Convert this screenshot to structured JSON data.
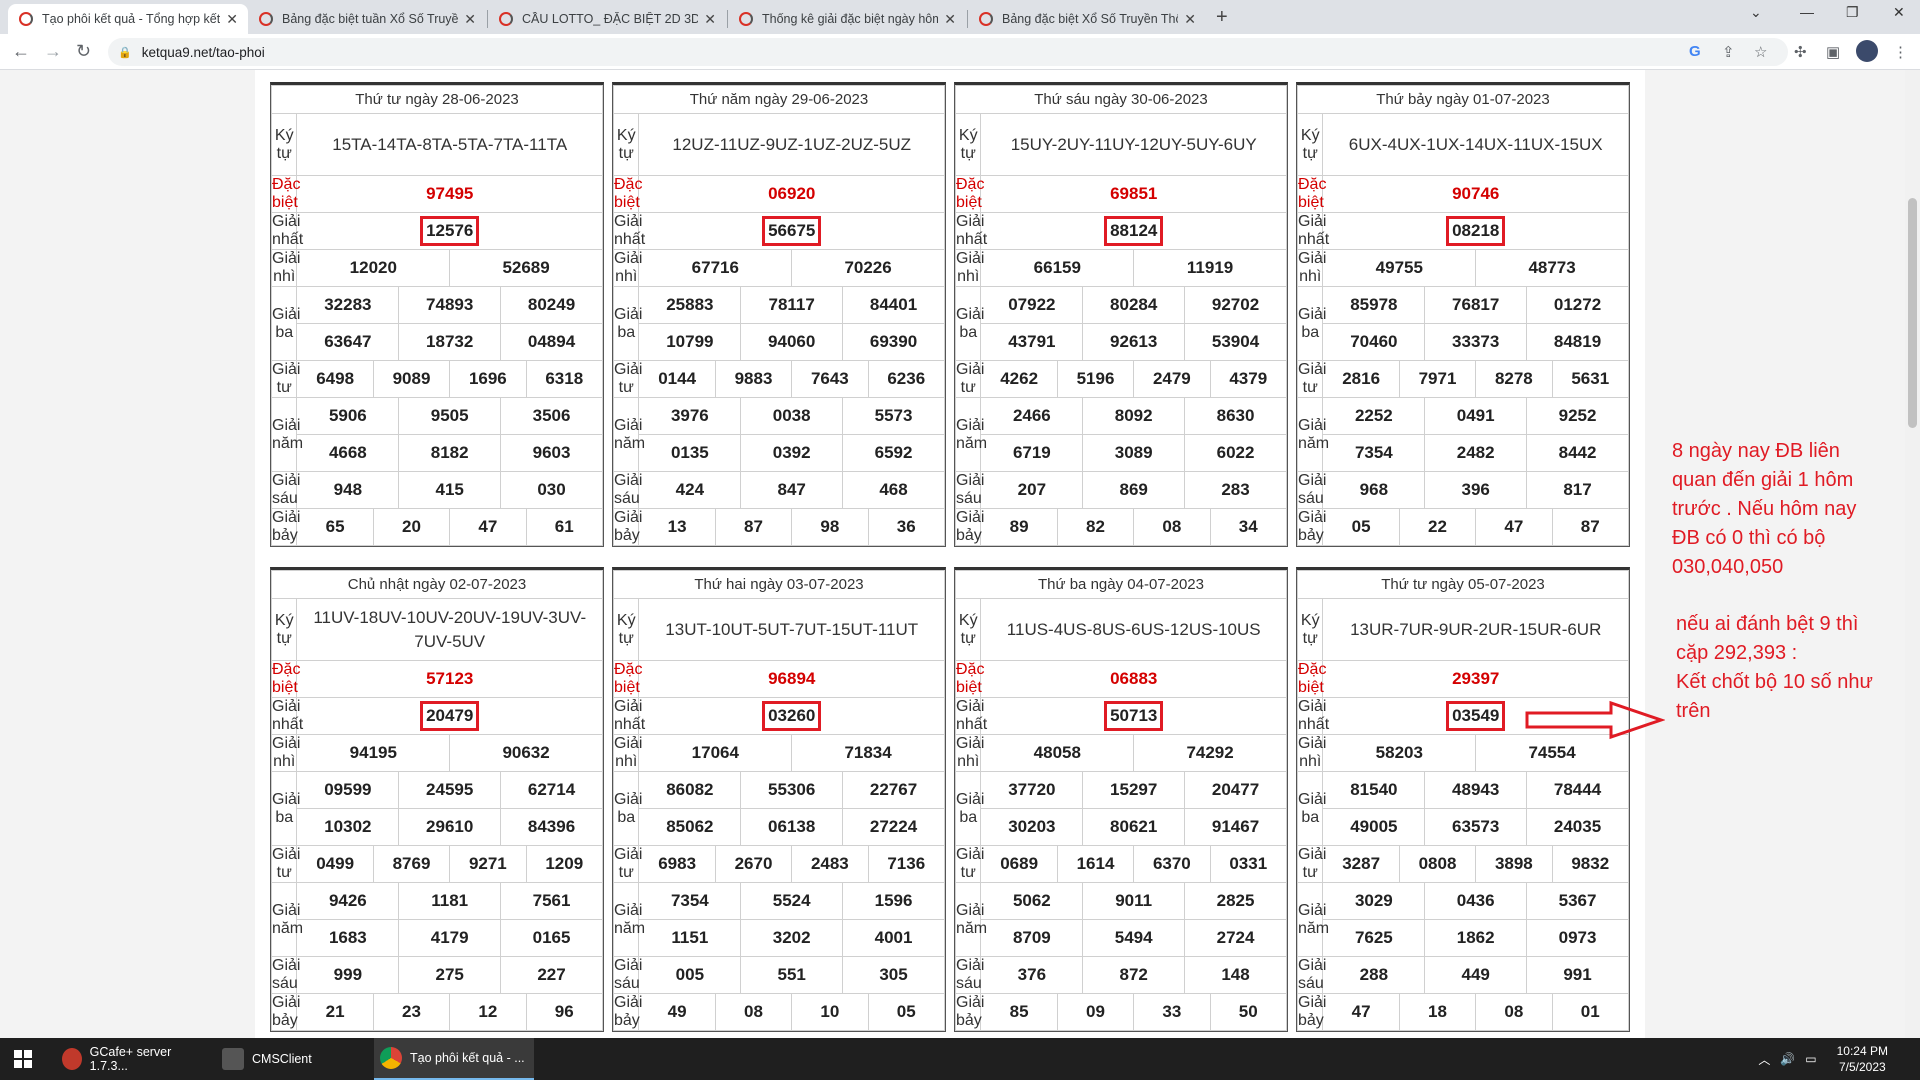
{
  "browser": {
    "tabs": [
      {
        "title": "Tạo phôi kết quả - Tổng hợp kết",
        "active": true
      },
      {
        "title": "Bảng đặc biệt tuần Xổ Số Truyền",
        "active": false
      },
      {
        "title": "CẦU LOTTO_ ĐẶC BIỆT 2D 3D 4D",
        "active": false
      },
      {
        "title": "Thống kê giải đặc biệt ngày hôm",
        "active": false
      },
      {
        "title": "Bảng đặc biệt Xổ Số Truyền Thốn",
        "active": false
      }
    ],
    "url": "ketqua9.net/tao-phoi"
  },
  "labels": {
    "kytu": "Ký tự",
    "db": "Đặc biệt",
    "g1": "Giải nhất",
    "g2": "Giải nhì",
    "g3": "Giải ba",
    "g4": "Giải tư",
    "g5": "Giải năm",
    "g6": "Giải sáu",
    "g7": "Giải bảy"
  },
  "results": [
    {
      "date": "Thứ tư ngày 28-06-2023",
      "kytu": "15TA-14TA-8TA-5TA-7TA-11TA",
      "db": "97495",
      "g1": "12576",
      "g2": [
        "12020",
        "52689"
      ],
      "g3": [
        "32283",
        "74893",
        "80249",
        "63647",
        "18732",
        "04894"
      ],
      "g4": [
        "6498",
        "9089",
        "1696",
        "6318"
      ],
      "g5": [
        "5906",
        "9505",
        "3506",
        "4668",
        "8182",
        "9603"
      ],
      "g6": [
        "948",
        "415",
        "030"
      ],
      "g7": [
        "65",
        "20",
        "47",
        "61"
      ]
    },
    {
      "date": "Thứ năm ngày 29-06-2023",
      "kytu": "12UZ-11UZ-9UZ-1UZ-2UZ-5UZ",
      "db": "06920",
      "g1": "56675",
      "g2": [
        "67716",
        "70226"
      ],
      "g3": [
        "25883",
        "78117",
        "84401",
        "10799",
        "94060",
        "69390"
      ],
      "g4": [
        "0144",
        "9883",
        "7643",
        "6236"
      ],
      "g5": [
        "3976",
        "0038",
        "5573",
        "0135",
        "0392",
        "6592"
      ],
      "g6": [
        "424",
        "847",
        "468"
      ],
      "g7": [
        "13",
        "87",
        "98",
        "36"
      ]
    },
    {
      "date": "Thứ sáu ngày 30-06-2023",
      "kytu": "15UY-2UY-11UY-12UY-5UY-6UY",
      "db": "69851",
      "g1": "88124",
      "g2": [
        "66159",
        "11919"
      ],
      "g3": [
        "07922",
        "80284",
        "92702",
        "43791",
        "92613",
        "53904"
      ],
      "g4": [
        "4262",
        "5196",
        "2479",
        "4379"
      ],
      "g5": [
        "2466",
        "8092",
        "8630",
        "6719",
        "3089",
        "6022"
      ],
      "g6": [
        "207",
        "869",
        "283"
      ],
      "g7": [
        "89",
        "82",
        "08",
        "34"
      ]
    },
    {
      "date": "Thứ bảy ngày 01-07-2023",
      "kytu": "6UX-4UX-1UX-14UX-11UX-15UX",
      "db": "90746",
      "g1": "08218",
      "g2": [
        "49755",
        "48773"
      ],
      "g3": [
        "85978",
        "76817",
        "01272",
        "70460",
        "33373",
        "84819"
      ],
      "g4": [
        "2816",
        "7971",
        "8278",
        "5631"
      ],
      "g5": [
        "2252",
        "0491",
        "9252",
        "7354",
        "2482",
        "8442"
      ],
      "g6": [
        "968",
        "396",
        "817"
      ],
      "g7": [
        "05",
        "22",
        "47",
        "87"
      ]
    },
    {
      "date": "Chủ nhật ngày 02-07-2023",
      "kytu": "11UV-18UV-10UV-20UV-19UV-3UV-7UV-5UV",
      "db": "57123",
      "g1": "20479",
      "g2": [
        "94195",
        "90632"
      ],
      "g3": [
        "09599",
        "24595",
        "62714",
        "10302",
        "29610",
        "84396"
      ],
      "g4": [
        "0499",
        "8769",
        "9271",
        "1209"
      ],
      "g5": [
        "9426",
        "1181",
        "7561",
        "1683",
        "4179",
        "0165"
      ],
      "g6": [
        "999",
        "275",
        "227"
      ],
      "g7": [
        "21",
        "23",
        "12",
        "96"
      ]
    },
    {
      "date": "Thứ hai ngày 03-07-2023",
      "kytu": "13UT-10UT-5UT-7UT-15UT-11UT",
      "db": "96894",
      "g1": "03260",
      "g2": [
        "17064",
        "71834"
      ],
      "g3": [
        "86082",
        "55306",
        "22767",
        "85062",
        "06138",
        "27224"
      ],
      "g4": [
        "6983",
        "2670",
        "2483",
        "7136"
      ],
      "g5": [
        "7354",
        "5524",
        "1596",
        "1151",
        "3202",
        "4001"
      ],
      "g6": [
        "005",
        "551",
        "305"
      ],
      "g7": [
        "49",
        "08",
        "10",
        "05"
      ]
    },
    {
      "date": "Thứ ba ngày 04-07-2023",
      "kytu": "11US-4US-8US-6US-12US-10US",
      "db": "06883",
      "g1": "50713",
      "g2": [
        "48058",
        "74292"
      ],
      "g3": [
        "37720",
        "15297",
        "20477",
        "30203",
        "80621",
        "91467"
      ],
      "g4": [
        "0689",
        "1614",
        "6370",
        "0331"
      ],
      "g5": [
        "5062",
        "9011",
        "2825",
        "8709",
        "5494",
        "2724"
      ],
      "g6": [
        "376",
        "872",
        "148"
      ],
      "g7": [
        "85",
        "09",
        "33",
        "50"
      ]
    },
    {
      "date": "Thứ tư ngày 05-07-2023",
      "kytu": "13UR-7UR-9UR-2UR-15UR-6UR",
      "db": "29397",
      "g1": "03549",
      "g2": [
        "58203",
        "74554"
      ],
      "g3": [
        "81540",
        "48943",
        "78444",
        "49005",
        "63573",
        "24035"
      ],
      "g4": [
        "3287",
        "0808",
        "3898",
        "9832"
      ],
      "g5": [
        "3029",
        "0436",
        "5367",
        "7625",
        "1862",
        "0973"
      ],
      "g6": [
        "288",
        "449",
        "991"
      ],
      "g7": [
        "47",
        "18",
        "08",
        "01"
      ]
    }
  ],
  "annotations": {
    "note1": [
      "8 ngày nay ĐB liên",
      "quan đến giải 1 hôm",
      "trước . Nếu hôm nay",
      "ĐB có 0 thì có bộ",
      "030,040,050"
    ],
    "note2": [
      "nếu ai đánh bệt 9 thì",
      "cặp 292,393 :",
      "Kết chốt bộ 10 số như",
      "trên"
    ],
    "highlight_color": "#e01b24"
  },
  "taskbar": {
    "apps": [
      {
        "label": "GCafe+ server 1.7.3...",
        "icon": "gcafe-icon"
      },
      {
        "label": "CMSClient",
        "icon": "cmsclient-icon"
      },
      {
        "label": "Tạo phôi kết quả - ...",
        "icon": "chrome-icon"
      }
    ],
    "time": "10:24 PM",
    "date": "7/5/2023"
  }
}
